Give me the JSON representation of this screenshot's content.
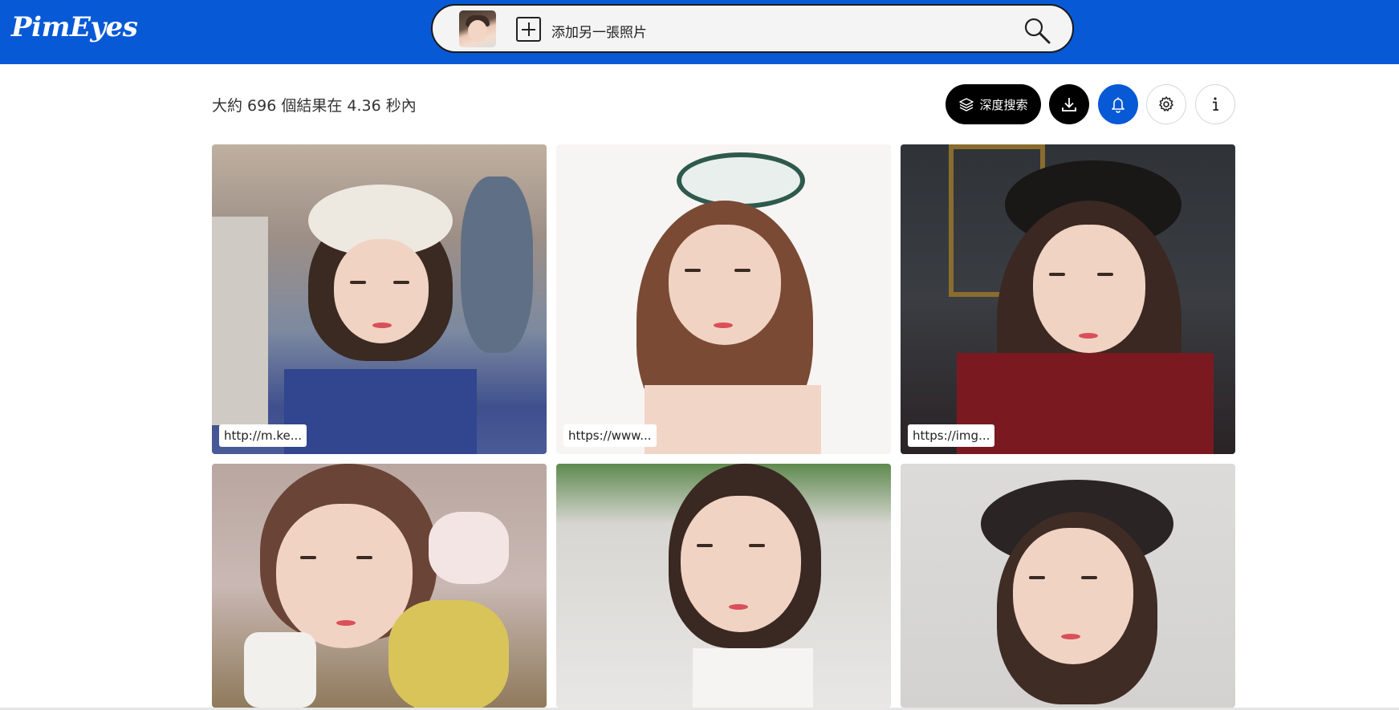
{
  "header": {
    "logo": "PimEyes",
    "search": {
      "add_label": "添加另一張照片"
    }
  },
  "results": {
    "summary": "大約 696 個結果在 4.36 秒內"
  },
  "toolbar": {
    "deep_search_label": "深度搜索"
  },
  "cards": [
    {
      "url": "http://m.ke..."
    },
    {
      "url": "https://www..."
    },
    {
      "url": "https://img..."
    },
    {
      "url": ""
    },
    {
      "url": ""
    },
    {
      "url": ""
    }
  ],
  "colors": {
    "brand_blue": "#0759d6",
    "dark_button": "#000000"
  },
  "icons": [
    "search-icon",
    "plus-icon",
    "layers-icon",
    "download-icon",
    "bell-icon",
    "gear-icon",
    "info-icon"
  ]
}
